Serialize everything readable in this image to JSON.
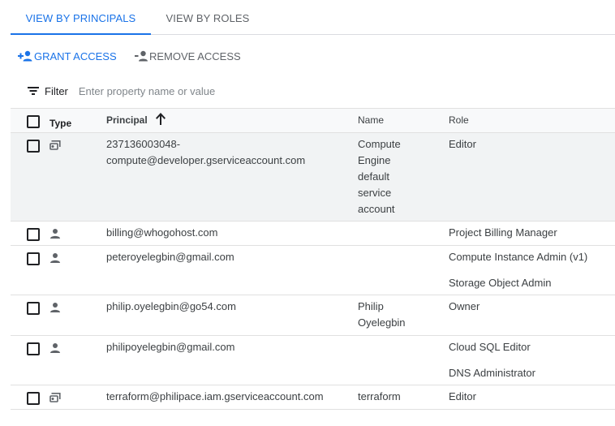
{
  "tabs": [
    {
      "label": "VIEW BY PRINCIPALS",
      "active": true
    },
    {
      "label": "VIEW BY ROLES",
      "active": false
    }
  ],
  "actions": {
    "grant_label": "GRANT ACCESS",
    "remove_label": "REMOVE ACCESS"
  },
  "filter": {
    "label": "Filter",
    "placeholder": "Enter property name or value"
  },
  "table": {
    "columns": {
      "type": "Type",
      "principal": "Principal",
      "name": "Name",
      "role": "Role"
    },
    "sort": {
      "column": "principal",
      "direction": "ascending",
      "icon": "arrow-up-icon"
    },
    "rows": [
      {
        "type_icon": "service-account-icon",
        "principal_lines": [
          "237136003048-",
          "compute@developer.gserviceaccount.com"
        ],
        "name_lines": [
          "Compute",
          "Engine",
          "default",
          "service",
          "account"
        ],
        "roles": [
          "Editor"
        ]
      },
      {
        "type_icon": "user-icon",
        "principal_lines": [
          "billing@whogohost.com"
        ],
        "name_lines": [],
        "roles": [
          "Project Billing Manager"
        ]
      },
      {
        "type_icon": "user-icon",
        "principal_lines": [
          "peteroyelegbin@gmail.com"
        ],
        "name_lines": [],
        "roles": [
          "Compute Instance Admin (v1)",
          "Storage Object Admin"
        ]
      },
      {
        "type_icon": "user-icon",
        "principal_lines": [
          "philip.oyelegbin@go54.com"
        ],
        "name_lines": [
          "Philip",
          "Oyelegbin"
        ],
        "roles": [
          "Owner"
        ]
      },
      {
        "type_icon": "user-icon",
        "principal_lines": [
          "philipoyelegbin@gmail.com"
        ],
        "name_lines": [],
        "roles": [
          "Cloud SQL Editor",
          "DNS Administrator"
        ]
      },
      {
        "type_icon": "service-account-icon",
        "principal_lines": [
          "terraform@philipace.iam.gserviceaccount.com"
        ],
        "name_lines": [
          "terraform"
        ],
        "roles": [
          "Editor"
        ]
      }
    ]
  }
}
